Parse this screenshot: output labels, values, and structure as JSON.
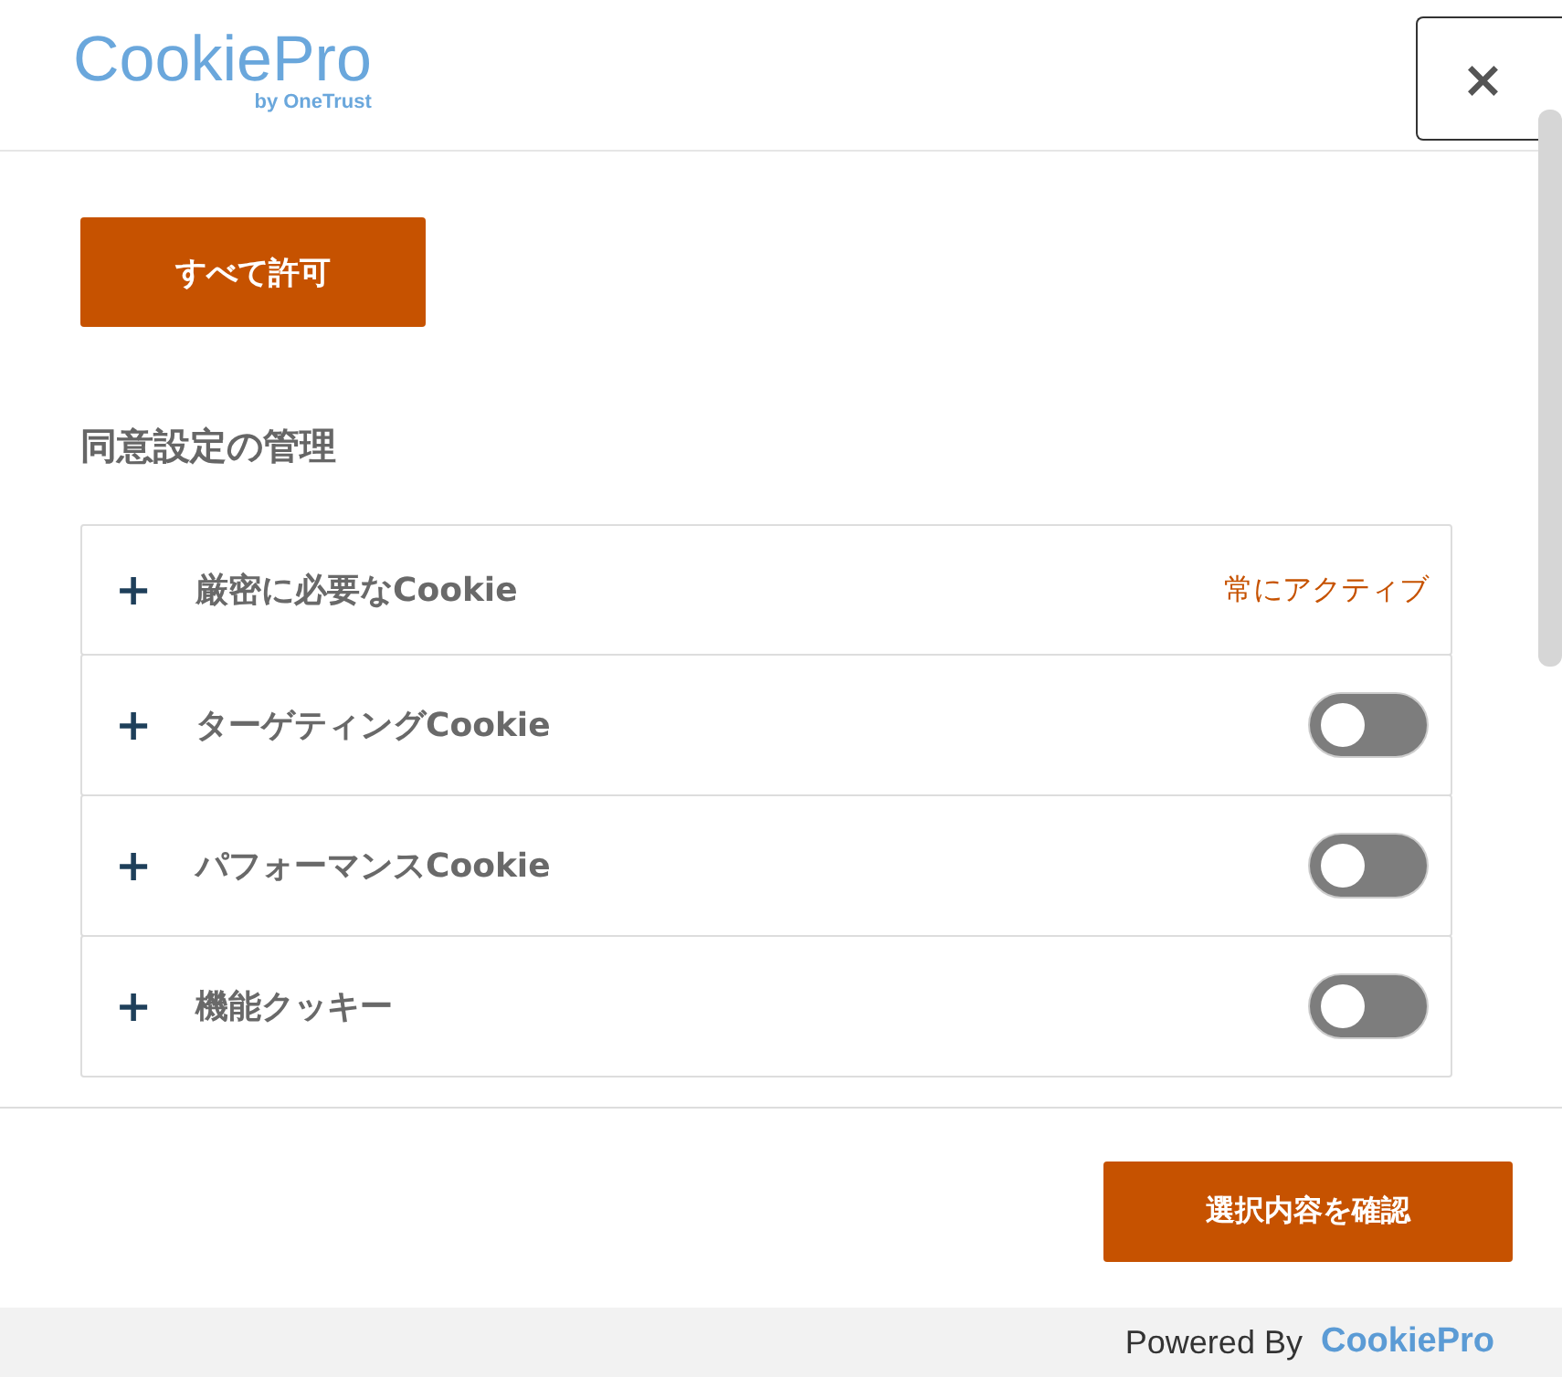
{
  "logo": {
    "name": "CookiePro",
    "sub": "by OneTrust"
  },
  "close": {
    "label": "×"
  },
  "allow_all": {
    "label": "すべて許可"
  },
  "heading": "同意設定の管理",
  "categories": [
    {
      "expand": "+",
      "name": "厳密に必要なCookie",
      "kind": "always_active",
      "status": "常にアクティブ"
    },
    {
      "expand": "+",
      "name": "ターゲティングCookie",
      "kind": "toggle",
      "on": false
    },
    {
      "expand": "+",
      "name": "パフォーマンスCookie",
      "kind": "toggle",
      "on": false
    },
    {
      "expand": "+",
      "name": "機能クッキー",
      "kind": "toggle",
      "on": false
    }
  ],
  "confirm": {
    "label": "選択内容を確認"
  },
  "powered": {
    "text": "Powered By",
    "brand": "CookiePro"
  }
}
